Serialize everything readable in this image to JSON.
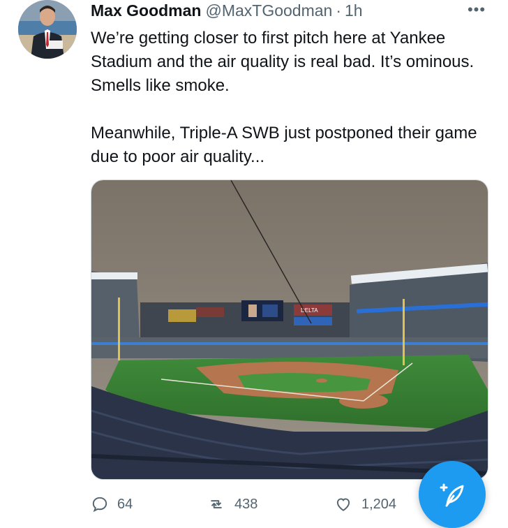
{
  "tweet": {
    "author_name": "Max Goodman",
    "handle": "@MaxTGoodman",
    "separator": "·",
    "time": "1h",
    "more_label": "•••",
    "paragraphs": [
      "We’re getting closer to first pitch here at Yankee Stadium and the air quality is real bad. It’s ominous. Smells like smoke.",
      "Meanwhile, Triple-A SWB just postponed their game due to poor air quality..."
    ],
    "photo": {
      "description_icon": "stadium-photo",
      "scoreboard_text": "DELTA"
    }
  },
  "actions": {
    "replies": "64",
    "retweets": "438",
    "likes": "1,204"
  },
  "fab": {
    "icon": "compose-tweet-icon"
  },
  "colors": {
    "accent": "#1d9bf0",
    "text": "#0f1419",
    "secondary": "#536471"
  }
}
